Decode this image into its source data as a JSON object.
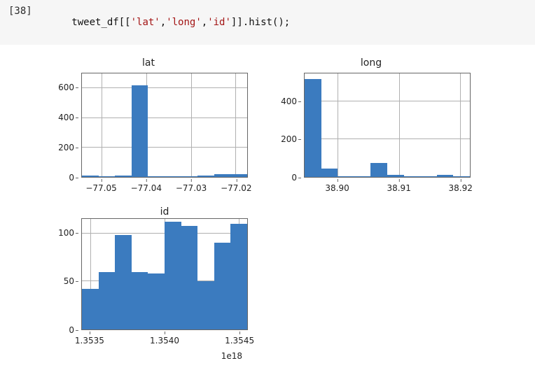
{
  "cell": {
    "prompt": "[38]",
    "code_prefix": "tweet_df[[",
    "str1": "'lat'",
    "comma1": ",",
    "str2": "'long'",
    "comma2": ",",
    "str3": "'id'",
    "code_suffix": "]].hist();"
  },
  "chart_data": [
    {
      "type": "bar",
      "title": "lat",
      "xticks": [
        "−77.05",
        "−77.04",
        "−77.03",
        "−77.02"
      ],
      "yticks": [
        "0",
        "200",
        "400",
        "600"
      ],
      "categories": [
        "b1",
        "b2",
        "b3",
        "b4",
        "b5",
        "b6",
        "b7",
        "b8",
        "b9",
        "b10"
      ],
      "values": [
        8,
        5,
        8,
        620,
        5,
        5,
        5,
        8,
        20,
        18
      ],
      "ylim": [
        0,
        700
      ],
      "xlim": [
        -77.055,
        -77.015
      ],
      "xtick_positions": [
        0.12,
        0.39,
        0.66,
        0.93
      ]
    },
    {
      "type": "bar",
      "title": "long",
      "xticks": [
        "38.90",
        "38.91",
        "38.92"
      ],
      "yticks": [
        "0",
        "200",
        "400"
      ],
      "categories": [
        "b1",
        "b2",
        "b3",
        "b4",
        "b5",
        "b6",
        "b7",
        "b8",
        "b9",
        "b10"
      ],
      "values": [
        520,
        45,
        5,
        5,
        75,
        10,
        5,
        5,
        10,
        5
      ],
      "ylim": [
        0,
        550
      ],
      "xlim": [
        38.895,
        38.922
      ],
      "xtick_positions": [
        0.2,
        0.57,
        0.94
      ]
    },
    {
      "type": "bar",
      "title": "id",
      "xticks": [
        "1.3535",
        "1.3540",
        "1.3545"
      ],
      "yticks": [
        "0",
        "50",
        "100"
      ],
      "offset_text": "1e18",
      "categories": [
        "b1",
        "b2",
        "b3",
        "b4",
        "b5",
        "b6",
        "b7",
        "b8",
        "b9",
        "b10"
      ],
      "values": [
        42,
        60,
        98,
        60,
        58,
        112,
        108,
        50,
        90,
        110
      ],
      "ylim": [
        0,
        115
      ],
      "xlim": [
        1.35345,
        1.35455
      ],
      "xtick_positions": [
        0.05,
        0.5,
        0.95
      ]
    }
  ]
}
